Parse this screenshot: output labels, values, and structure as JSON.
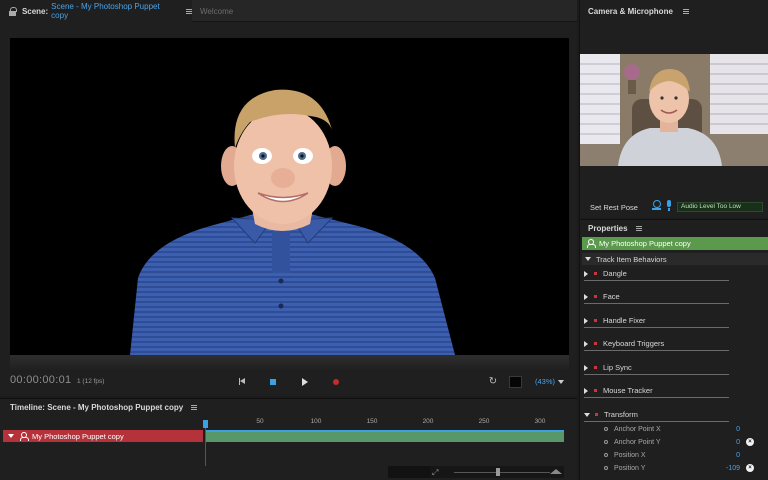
{
  "scene": {
    "tab_scene_label": "Scene:",
    "tab_scene_doc": "Scene - My Photoshop Puppet copy",
    "tab_welcome_label": "Welcome"
  },
  "transport": {
    "timecode": "00:00:00:01",
    "fps": "1 (12 fps)",
    "zoom": "(43%)"
  },
  "timeline": {
    "title": "Timeline: Scene - My Photoshop Puppet copy",
    "ruler_ticks": [
      "50",
      "100",
      "150",
      "200",
      "250",
      "300"
    ],
    "track_label": "My Photoshop Puppet copy"
  },
  "camera": {
    "title": "Camera & Microphone",
    "set_rest_pose": "Set Rest Pose",
    "audio_level": "Audio Level Too Low"
  },
  "properties": {
    "title": "Properties",
    "puppet_name": "My Photoshop Puppet copy",
    "section_title": "Track Item Behaviors",
    "behaviors": [
      "Dangle",
      "Face",
      "Handle Fixer",
      "Keyboard Triggers",
      "Lip Sync",
      "Mouse Tracker",
      "Transform"
    ],
    "transform_params": [
      {
        "label": "Anchor Point X",
        "value": "0"
      },
      {
        "label": "Anchor Point Y",
        "value": "0"
      },
      {
        "label": "Position X",
        "value": "0"
      },
      {
        "label": "Position Y",
        "value": "-109"
      }
    ]
  },
  "colors": {
    "accent_blue": "#3aa2e4",
    "track_red": "#b6323b",
    "puppet_green": "#5b9a4c",
    "record_red": "#c62a2a"
  }
}
